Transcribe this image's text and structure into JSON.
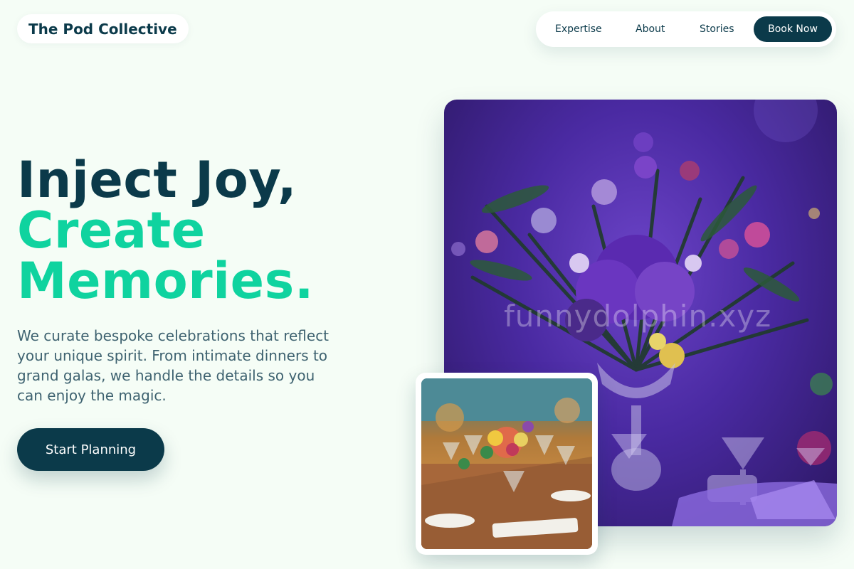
{
  "brand": {
    "name": "The Pod Collective"
  },
  "nav": {
    "links": [
      "Expertise",
      "About",
      "Stories"
    ],
    "cta": "Book Now"
  },
  "hero": {
    "title_line1": "Inject Joy,",
    "title_line2": "Create",
    "title_line3": "Memories.",
    "subtitle": "We curate bespoke celebrations that reflect your unique spirit. From intimate dinners to grand galas, we handle the details so you can enjoy the magic.",
    "cta": "Start Planning"
  },
  "images": {
    "main": "purple floral centerpiece with wine glasses on an event table",
    "secondary": "long dining table with colorful flower arrangements and glassware",
    "watermark": "funnydolphin.xyz"
  },
  "colors": {
    "primary": "#0b3a4a",
    "accent": "#0fd39f",
    "background": "#f5fdf6",
    "body_text": "#3e6270"
  }
}
